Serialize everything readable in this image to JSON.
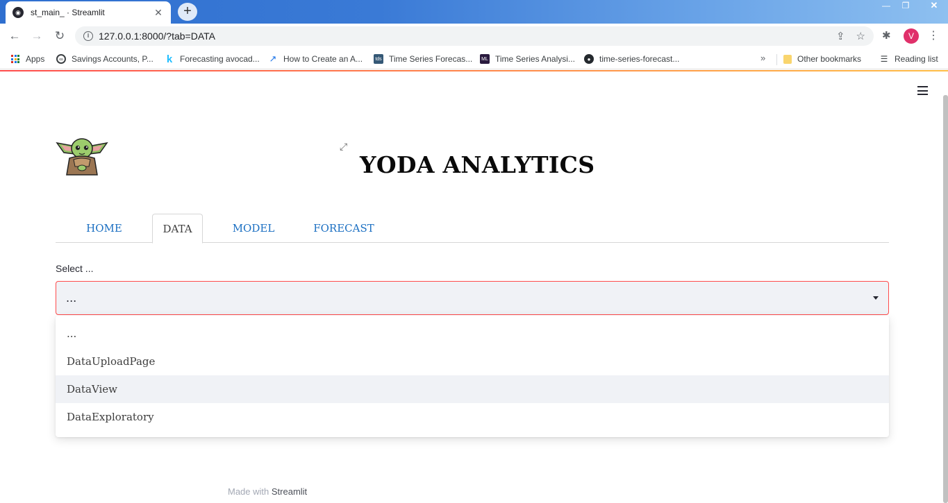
{
  "browser": {
    "tab_title": "st_main_ · Streamlit",
    "tab_close": "✕",
    "new_tab": "+",
    "url": "127.0.0.1:8000/?tab=DATA",
    "profile_initial": "V",
    "window_controls": {
      "minimize": "—",
      "maximize": "❐",
      "close": "✕"
    }
  },
  "bookmarks": {
    "items": [
      {
        "label": "Apps",
        "icon": "apps-grid-icon"
      },
      {
        "label": "Savings Accounts, P...",
        "icon": "savings-icon"
      },
      {
        "label": "Forecasting avocad...",
        "icon": "kaggle-icon"
      },
      {
        "label": "How to Create an A...",
        "icon": "trend-icon"
      },
      {
        "label": "Time Series Forecas...",
        "icon": "tds-icon"
      },
      {
        "label": "Time Series Analysi...",
        "icon": "ml-icon"
      },
      {
        "label": "time-series-forecast...",
        "icon": "github-icon"
      }
    ],
    "other": "Other bookmarks",
    "reading_list": "Reading list",
    "overflow": "»"
  },
  "app": {
    "title": "YODA ANALYTICS",
    "tabs": [
      {
        "label": "HOME",
        "active": false
      },
      {
        "label": "DATA",
        "active": true
      },
      {
        "label": "MODEL",
        "active": false
      },
      {
        "label": "FORECAST",
        "active": false
      }
    ],
    "select": {
      "label": "Select ...",
      "value": "...",
      "options": [
        "...",
        "DataUploadPage",
        "DataView",
        "DataExploratory"
      ],
      "highlighted": "DataView"
    },
    "footer": {
      "prefix": "Made with ",
      "brand": "Streamlit"
    }
  },
  "colors": {
    "accent": "#ff4b4b",
    "tab_link": "#1b6fc2",
    "select_bg": "#f0f2f6",
    "profile": "#e0306a"
  }
}
